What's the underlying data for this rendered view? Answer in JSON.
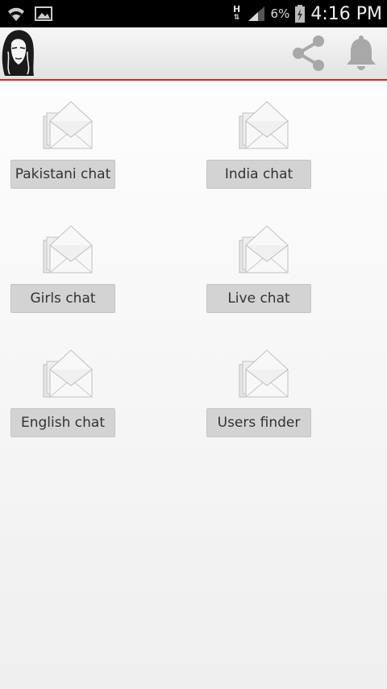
{
  "status_bar": {
    "network_type": "H",
    "battery_percent": "6%",
    "time": "4:16 PM",
    "icons": [
      "wifi-icon",
      "image-icon",
      "network-arrows-icon",
      "signal-icon",
      "battery-charging-icon"
    ]
  },
  "action_bar": {
    "logo_icon": "woman-face-logo",
    "share_icon": "share-icon",
    "bell_icon": "bell-icon",
    "accent_color": "#d9242e"
  },
  "tiles": [
    {
      "label": "Pakistani chat",
      "icon": "envelope-icon"
    },
    {
      "label": "India chat",
      "icon": "envelope-icon"
    },
    {
      "label": "Girls chat",
      "icon": "envelope-icon"
    },
    {
      "label": "Live chat",
      "icon": "envelope-icon"
    },
    {
      "label": "English chat",
      "icon": "envelope-icon"
    },
    {
      "label": "Users finder",
      "icon": "envelope-icon"
    }
  ]
}
